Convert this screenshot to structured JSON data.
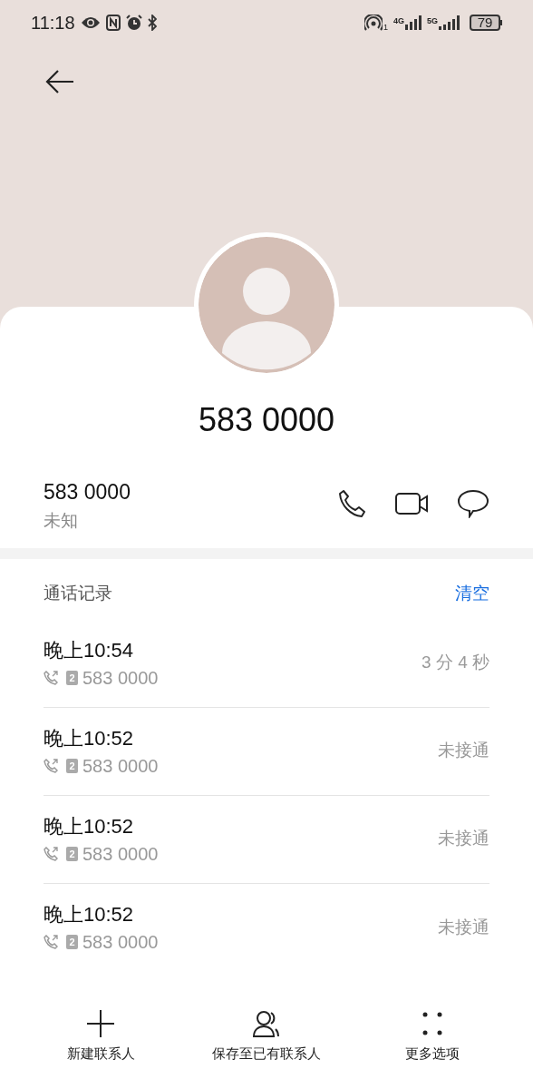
{
  "status_bar": {
    "time": "11:18",
    "hotspot_count": "1",
    "network_1": "4G",
    "network_2": "5G",
    "battery": "79"
  },
  "contact": {
    "name": "583 0000",
    "number": "583 0000",
    "location": "未知"
  },
  "call_log": {
    "title": "通话记录",
    "clear_action": "清空",
    "entries": [
      {
        "time": "晚上10:54",
        "sim": "2",
        "number": "583 0000",
        "result": "3 分 4 秒"
      },
      {
        "time": "晚上10:52",
        "sim": "2",
        "number": "583 0000",
        "result": "未接通"
      },
      {
        "time": "晚上10:52",
        "sim": "2",
        "number": "583 0000",
        "result": "未接通"
      },
      {
        "time": "晚上10:52",
        "sim": "2",
        "number": "583 0000",
        "result": "未接通"
      }
    ]
  },
  "bottom_actions": [
    {
      "kind": "add",
      "label": "新建联系人"
    },
    {
      "kind": "save",
      "label": "保存至已有联系人"
    },
    {
      "kind": "more",
      "label": "更多选项"
    }
  ]
}
